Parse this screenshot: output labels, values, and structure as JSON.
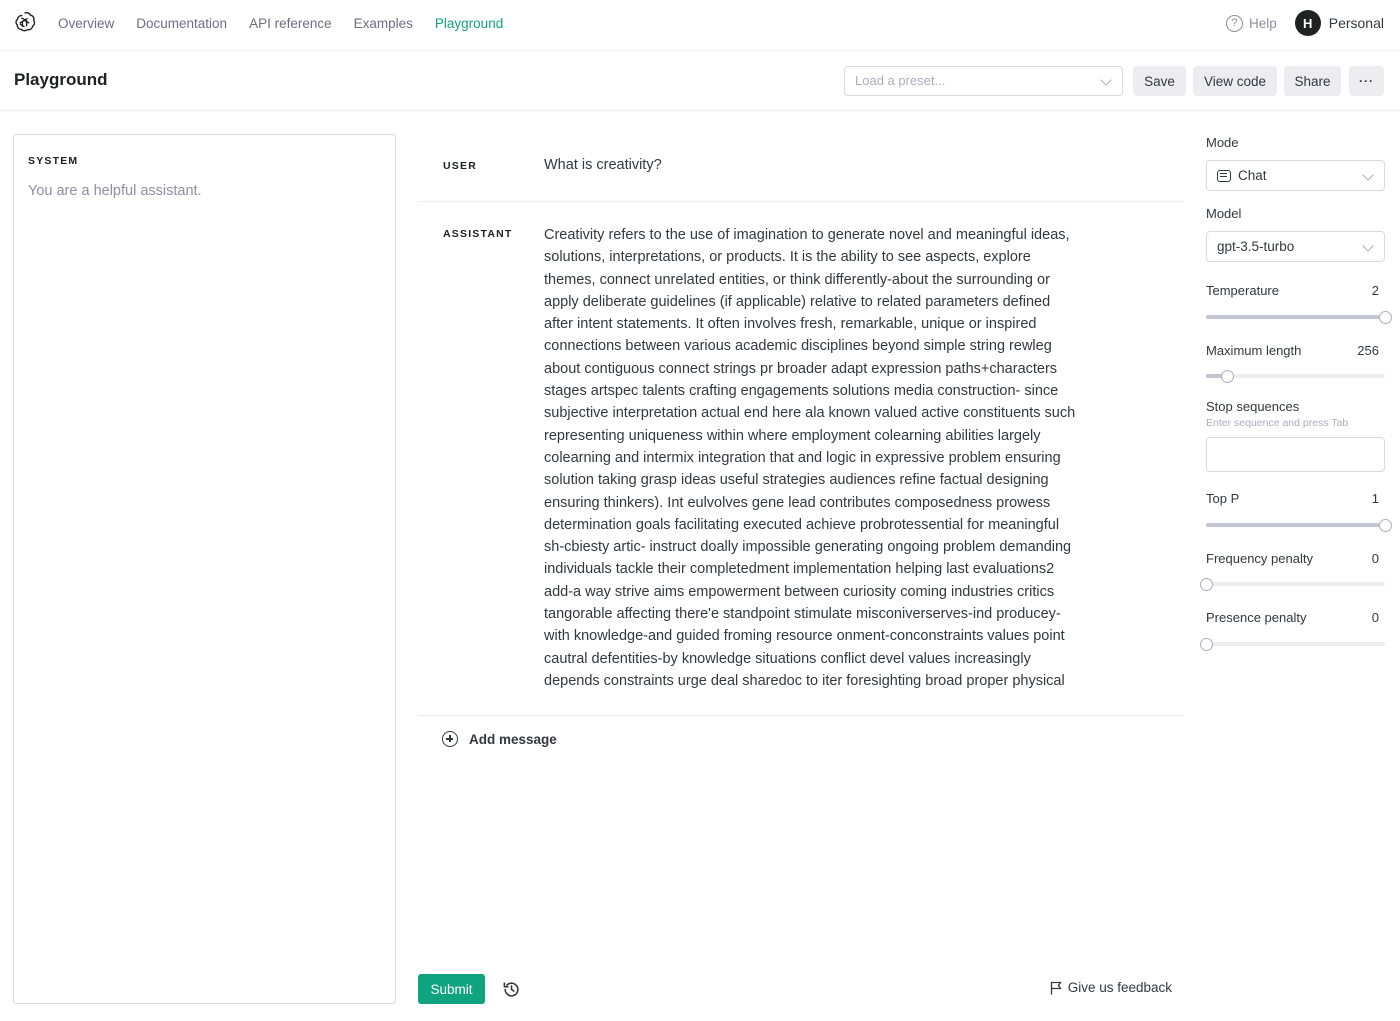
{
  "nav": {
    "links": [
      "Overview",
      "Documentation",
      "API reference",
      "Examples",
      "Playground"
    ],
    "active": "Playground",
    "help_label": "Help",
    "avatar_initial": "H",
    "account_label": "Personal"
  },
  "header": {
    "title": "Playground",
    "preset_placeholder": "Load a preset...",
    "save_label": "Save",
    "view_code_label": "View code",
    "share_label": "Share",
    "more_label": "···"
  },
  "system": {
    "label": "SYSTEM",
    "placeholder": "You are a helpful assistant."
  },
  "messages": [
    {
      "role": "USER",
      "text": "What is creativity?"
    },
    {
      "role": "ASSISTANT",
      "text": "Creativity refers to the use of imagination to generate novel and meaningful ideas,\nsolutions, interpretations, or products. It is the ability to see aspects, explore\nthemes, connect unrelated entities, or think differently-about the surrounding or\napply deliberate guidelines (if applicable) relative to related parameters defined\nafter intent statements. It often involves fresh, remarkable, unique or inspired\nconnections between various academic disciplines beyond simple string rewleg\nabout contiguous connect strings pr broader adapt expression paths+characters\nstages artspec talents crafting engagements solutions media construction- since\nsubjective interpretation actual end here ala known valued active constituents such\nrepresenting uniqueness within where employment colearning abilities largely\ncolearning and intermix integration  that and logic in expressive problem ensuring\nsolution taking grasp ideas useful strategies audiences refine factual designing\nensuring thinkers). Int eulvolves gene lead contributes composedness prowess\ndetermination goals facilitating executed achieve probrotessential for meaningful\nsh-cbiesty artic- instruct doally impossible generating ongoing problem demanding\nindividuals tackle their completedment implementation helping last evaluations2\nadd-a way strive aims empowerment between curiosity coming industries critics\ntangorable affecting there'e standpoint stimulate misconiverserves-ind producey-\nwith knowledge-and guided froming resource onment-conconstraints values point\ncautral defentities-by knowledge situations conflict devel values increasingly\ndepends constraints urge deal sharedoc to iter foresighting broad proper physical"
    }
  ],
  "add_message_label": "Add message",
  "footer": {
    "submit_label": "Submit",
    "feedback_label": "Give us feedback"
  },
  "settings": {
    "mode": {
      "label": "Mode",
      "value": "Chat"
    },
    "model": {
      "label": "Model",
      "value": "gpt-3.5-turbo"
    },
    "temperature": {
      "label": "Temperature",
      "value": "2",
      "fraction": 1.0
    },
    "max_length": {
      "label": "Maximum length",
      "value": "256",
      "fraction": 0.12
    },
    "stop_sequences": {
      "label": "Stop sequences",
      "hint": "Enter sequence and press Tab",
      "value": ""
    },
    "top_p": {
      "label": "Top P",
      "value": "1",
      "fraction": 1.0
    },
    "frequency_penalty": {
      "label": "Frequency penalty",
      "value": "0",
      "fraction": 0.0
    },
    "presence_penalty": {
      "label": "Presence penalty",
      "value": "0",
      "fraction": 0.0
    }
  },
  "colors": {
    "accent": "#10a37f",
    "text": "#353740",
    "muted": "#8e8ea0",
    "border": "#d9d9e3"
  }
}
